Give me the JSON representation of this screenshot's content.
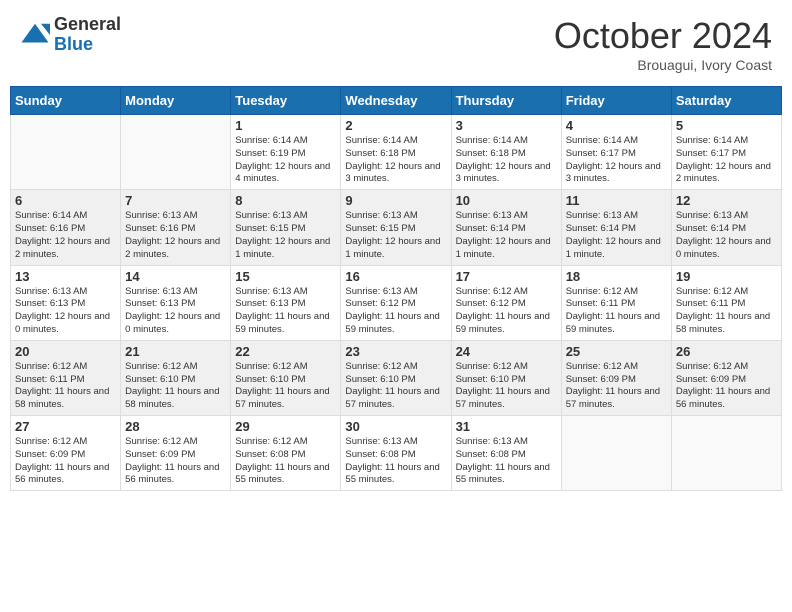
{
  "header": {
    "logo_general": "General",
    "logo_blue": "Blue",
    "month": "October 2024",
    "location": "Brouagui, Ivory Coast"
  },
  "days_of_week": [
    "Sunday",
    "Monday",
    "Tuesday",
    "Wednesday",
    "Thursday",
    "Friday",
    "Saturday"
  ],
  "weeks": [
    [
      {
        "day": "",
        "info": ""
      },
      {
        "day": "",
        "info": ""
      },
      {
        "day": "1",
        "info": "Sunrise: 6:14 AM\nSunset: 6:19 PM\nDaylight: 12 hours and 4 minutes."
      },
      {
        "day": "2",
        "info": "Sunrise: 6:14 AM\nSunset: 6:18 PM\nDaylight: 12 hours and 3 minutes."
      },
      {
        "day": "3",
        "info": "Sunrise: 6:14 AM\nSunset: 6:18 PM\nDaylight: 12 hours and 3 minutes."
      },
      {
        "day": "4",
        "info": "Sunrise: 6:14 AM\nSunset: 6:17 PM\nDaylight: 12 hours and 3 minutes."
      },
      {
        "day": "5",
        "info": "Sunrise: 6:14 AM\nSunset: 6:17 PM\nDaylight: 12 hours and 2 minutes."
      }
    ],
    [
      {
        "day": "6",
        "info": "Sunrise: 6:14 AM\nSunset: 6:16 PM\nDaylight: 12 hours and 2 minutes."
      },
      {
        "day": "7",
        "info": "Sunrise: 6:13 AM\nSunset: 6:16 PM\nDaylight: 12 hours and 2 minutes."
      },
      {
        "day": "8",
        "info": "Sunrise: 6:13 AM\nSunset: 6:15 PM\nDaylight: 12 hours and 1 minute."
      },
      {
        "day": "9",
        "info": "Sunrise: 6:13 AM\nSunset: 6:15 PM\nDaylight: 12 hours and 1 minute."
      },
      {
        "day": "10",
        "info": "Sunrise: 6:13 AM\nSunset: 6:14 PM\nDaylight: 12 hours and 1 minute."
      },
      {
        "day": "11",
        "info": "Sunrise: 6:13 AM\nSunset: 6:14 PM\nDaylight: 12 hours and 1 minute."
      },
      {
        "day": "12",
        "info": "Sunrise: 6:13 AM\nSunset: 6:14 PM\nDaylight: 12 hours and 0 minutes."
      }
    ],
    [
      {
        "day": "13",
        "info": "Sunrise: 6:13 AM\nSunset: 6:13 PM\nDaylight: 12 hours and 0 minutes."
      },
      {
        "day": "14",
        "info": "Sunrise: 6:13 AM\nSunset: 6:13 PM\nDaylight: 12 hours and 0 minutes."
      },
      {
        "day": "15",
        "info": "Sunrise: 6:13 AM\nSunset: 6:13 PM\nDaylight: 11 hours and 59 minutes."
      },
      {
        "day": "16",
        "info": "Sunrise: 6:13 AM\nSunset: 6:12 PM\nDaylight: 11 hours and 59 minutes."
      },
      {
        "day": "17",
        "info": "Sunrise: 6:12 AM\nSunset: 6:12 PM\nDaylight: 11 hours and 59 minutes."
      },
      {
        "day": "18",
        "info": "Sunrise: 6:12 AM\nSunset: 6:11 PM\nDaylight: 11 hours and 59 minutes."
      },
      {
        "day": "19",
        "info": "Sunrise: 6:12 AM\nSunset: 6:11 PM\nDaylight: 11 hours and 58 minutes."
      }
    ],
    [
      {
        "day": "20",
        "info": "Sunrise: 6:12 AM\nSunset: 6:11 PM\nDaylight: 11 hours and 58 minutes."
      },
      {
        "day": "21",
        "info": "Sunrise: 6:12 AM\nSunset: 6:10 PM\nDaylight: 11 hours and 58 minutes."
      },
      {
        "day": "22",
        "info": "Sunrise: 6:12 AM\nSunset: 6:10 PM\nDaylight: 11 hours and 57 minutes."
      },
      {
        "day": "23",
        "info": "Sunrise: 6:12 AM\nSunset: 6:10 PM\nDaylight: 11 hours and 57 minutes."
      },
      {
        "day": "24",
        "info": "Sunrise: 6:12 AM\nSunset: 6:10 PM\nDaylight: 11 hours and 57 minutes."
      },
      {
        "day": "25",
        "info": "Sunrise: 6:12 AM\nSunset: 6:09 PM\nDaylight: 11 hours and 57 minutes."
      },
      {
        "day": "26",
        "info": "Sunrise: 6:12 AM\nSunset: 6:09 PM\nDaylight: 11 hours and 56 minutes."
      }
    ],
    [
      {
        "day": "27",
        "info": "Sunrise: 6:12 AM\nSunset: 6:09 PM\nDaylight: 11 hours and 56 minutes."
      },
      {
        "day": "28",
        "info": "Sunrise: 6:12 AM\nSunset: 6:09 PM\nDaylight: 11 hours and 56 minutes."
      },
      {
        "day": "29",
        "info": "Sunrise: 6:12 AM\nSunset: 6:08 PM\nDaylight: 11 hours and 55 minutes."
      },
      {
        "day": "30",
        "info": "Sunrise: 6:13 AM\nSunset: 6:08 PM\nDaylight: 11 hours and 55 minutes."
      },
      {
        "day": "31",
        "info": "Sunrise: 6:13 AM\nSunset: 6:08 PM\nDaylight: 11 hours and 55 minutes."
      },
      {
        "day": "",
        "info": ""
      },
      {
        "day": "",
        "info": ""
      }
    ]
  ]
}
